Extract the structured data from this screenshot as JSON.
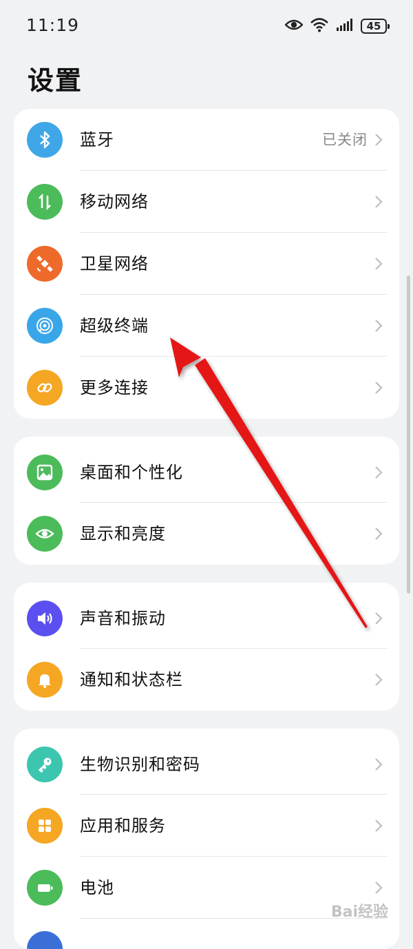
{
  "status_bar": {
    "time": "11:19",
    "battery_level": "45",
    "icons": [
      "eye-comfort-icon",
      "wifi-icon",
      "signal-icon",
      "battery-icon"
    ]
  },
  "page": {
    "title": "设置"
  },
  "groups": [
    {
      "items": [
        {
          "label": "蓝牙",
          "value": "已关闭",
          "icon": "bluetooth-icon",
          "color": "#3fa7e8"
        },
        {
          "label": "移动网络",
          "icon": "mobile-network-icon",
          "color": "#4cbb5a"
        },
        {
          "label": "卫星网络",
          "icon": "satellite-icon",
          "color": "#ee6a2a"
        },
        {
          "label": "超级终端",
          "icon": "super-device-icon",
          "color": "#3aa6ea"
        },
        {
          "label": "更多连接",
          "icon": "link-icon",
          "color": "#f5a623"
        }
      ]
    },
    {
      "items": [
        {
          "label": "桌面和个性化",
          "icon": "wallpaper-icon",
          "color": "#4cbb5a"
        },
        {
          "label": "显示和亮度",
          "icon": "eye-icon",
          "color": "#4cbb5a"
        }
      ]
    },
    {
      "items": [
        {
          "label": "声音和振动",
          "icon": "sound-icon",
          "color": "#5b4ff0"
        },
        {
          "label": "通知和状态栏",
          "icon": "bell-icon",
          "color": "#f5a623"
        }
      ]
    },
    {
      "items": [
        {
          "label": "生物识别和密码",
          "icon": "key-icon",
          "color": "#3cc6b0"
        },
        {
          "label": "应用和服务",
          "icon": "apps-icon",
          "color": "#f5a623"
        },
        {
          "label": "电池",
          "icon": "battery-icon",
          "color": "#4cbb5a"
        }
      ]
    }
  ],
  "watermark": "Bai经验"
}
